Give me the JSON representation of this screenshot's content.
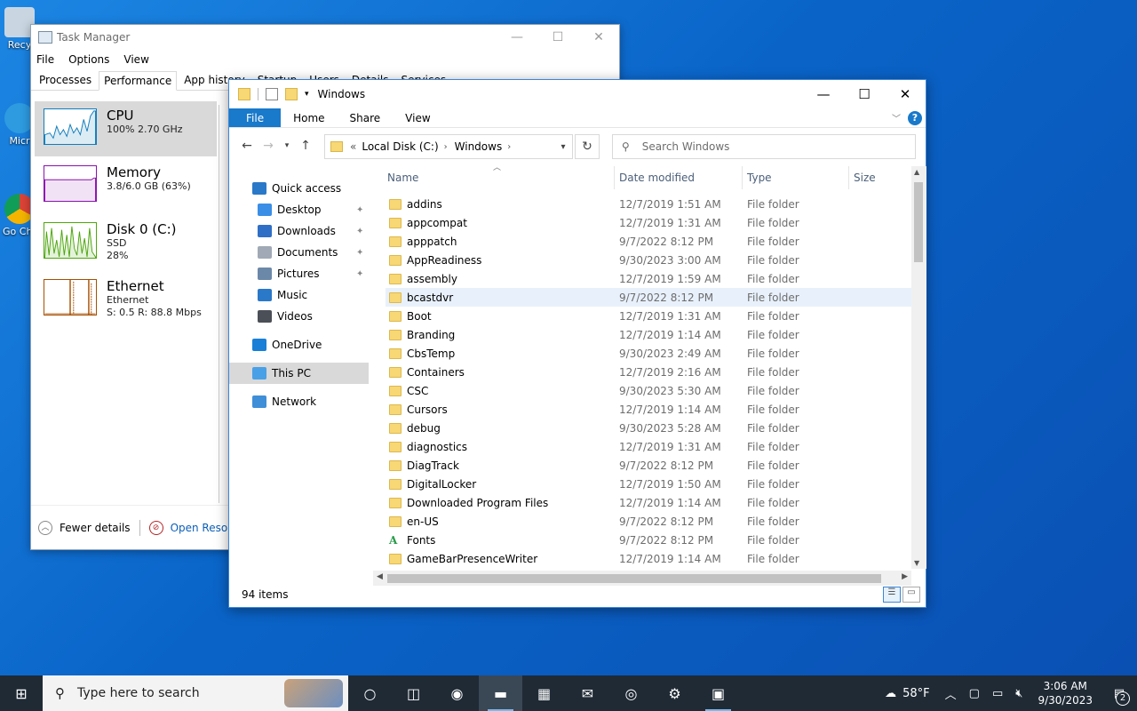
{
  "desktop": {
    "icons": [
      {
        "label": "Recy"
      },
      {
        "label": "Micr"
      },
      {
        "label": "Go Chr"
      }
    ]
  },
  "taskmgr": {
    "title": "Task Manager",
    "menu": [
      "File",
      "Options",
      "View"
    ],
    "tabs": [
      "Processes",
      "Performance",
      "App history",
      "Startup",
      "Users",
      "Details",
      "Services"
    ],
    "active_tab": "Performance",
    "perf_items": [
      {
        "name": "CPU",
        "line1": "100%  2.70 GHz",
        "line2": "",
        "color": "#117dbb"
      },
      {
        "name": "Memory",
        "line1": "3.8/6.0 GB (63%)",
        "line2": "",
        "color": "#8b12ae"
      },
      {
        "name": "Disk 0 (C:)",
        "line1": "SSD",
        "line2": "28%",
        "color": "#4da60c"
      },
      {
        "name": "Ethernet",
        "line1": "Ethernet",
        "line2": "S: 0.5  R: 88.8 Mbps",
        "color": "#a74f01"
      }
    ],
    "footer": {
      "fewer": "Fewer details",
      "resmon": "Open Resource"
    }
  },
  "explorer": {
    "title": "Windows",
    "ribbon_tabs": [
      "File",
      "Home",
      "Share",
      "View"
    ],
    "address": {
      "prefix": "«",
      "crumbs": [
        "Local Disk (C:)",
        "Windows"
      ]
    },
    "search_placeholder": "Search Windows",
    "nav": [
      {
        "label": "Quick access",
        "icon": "star-icon",
        "color": "#2a78c8",
        "level": 0,
        "pinned": false
      },
      {
        "label": "Desktop",
        "icon": "desktop-icon",
        "color": "#3a8ee6",
        "level": 1,
        "pinned": true
      },
      {
        "label": "Downloads",
        "icon": "download-icon",
        "color": "#2f6fc6",
        "level": 1,
        "pinned": true
      },
      {
        "label": "Documents",
        "icon": "document-icon",
        "color": "#a0a9b5",
        "level": 1,
        "pinned": true
      },
      {
        "label": "Pictures",
        "icon": "pictures-icon",
        "color": "#6b88a8",
        "level": 1,
        "pinned": true
      },
      {
        "label": "Music",
        "icon": "music-icon",
        "color": "#2a78c8",
        "level": 1,
        "pinned": false
      },
      {
        "label": "Videos",
        "icon": "video-icon",
        "color": "#4b4f57",
        "level": 1,
        "pinned": false
      },
      {
        "label": "OneDrive",
        "icon": "cloud-icon",
        "color": "#1a7fd6",
        "level": 0,
        "pinned": false
      },
      {
        "label": "This PC",
        "icon": "computer-icon",
        "color": "#4aa0e6",
        "level": 0,
        "pinned": false,
        "selected": true
      },
      {
        "label": "Network",
        "icon": "network-icon",
        "color": "#3f8fd8",
        "level": 0,
        "pinned": false
      }
    ],
    "columns": [
      "Name",
      "Date modified",
      "Type",
      "Size"
    ],
    "files": [
      {
        "name": "addins",
        "date": "12/7/2019 1:51 AM",
        "type": "File folder"
      },
      {
        "name": "appcompat",
        "date": "12/7/2019 1:31 AM",
        "type": "File folder"
      },
      {
        "name": "apppatch",
        "date": "9/7/2022 8:12 PM",
        "type": "File folder"
      },
      {
        "name": "AppReadiness",
        "date": "9/30/2023 3:00 AM",
        "type": "File folder"
      },
      {
        "name": "assembly",
        "date": "12/7/2019 1:59 AM",
        "type": "File folder"
      },
      {
        "name": "bcastdvr",
        "date": "9/7/2022 8:12 PM",
        "type": "File folder",
        "hover": true
      },
      {
        "name": "Boot",
        "date": "12/7/2019 1:31 AM",
        "type": "File folder"
      },
      {
        "name": "Branding",
        "date": "12/7/2019 1:14 AM",
        "type": "File folder"
      },
      {
        "name": "CbsTemp",
        "date": "9/30/2023 2:49 AM",
        "type": "File folder"
      },
      {
        "name": "Containers",
        "date": "12/7/2019 2:16 AM",
        "type": "File folder"
      },
      {
        "name": "CSC",
        "date": "9/30/2023 5:30 AM",
        "type": "File folder"
      },
      {
        "name": "Cursors",
        "date": "12/7/2019 1:14 AM",
        "type": "File folder"
      },
      {
        "name": "debug",
        "date": "9/30/2023 5:28 AM",
        "type": "File folder"
      },
      {
        "name": "diagnostics",
        "date": "12/7/2019 1:31 AM",
        "type": "File folder"
      },
      {
        "name": "DiagTrack",
        "date": "9/7/2022 8:12 PM",
        "type": "File folder"
      },
      {
        "name": "DigitalLocker",
        "date": "12/7/2019 1:50 AM",
        "type": "File folder"
      },
      {
        "name": "Downloaded Program Files",
        "date": "12/7/2019 1:14 AM",
        "type": "File folder"
      },
      {
        "name": "en-US",
        "date": "9/7/2022 8:12 PM",
        "type": "File folder"
      },
      {
        "name": "Fonts",
        "date": "9/7/2022 8:12 PM",
        "type": "File folder",
        "icon": "font"
      },
      {
        "name": "GameBarPresenceWriter",
        "date": "12/7/2019 1:14 AM",
        "type": "File folder"
      }
    ],
    "status": "94 items"
  },
  "taskbar": {
    "search_placeholder": "Type here to search",
    "apps": [
      {
        "name": "task-view-icon",
        "glyph": "◫"
      },
      {
        "name": "edge-icon",
        "glyph": "◉"
      },
      {
        "name": "file-explorer-icon",
        "glyph": "▬",
        "active": true
      },
      {
        "name": "store-icon",
        "glyph": "▦"
      },
      {
        "name": "mail-icon",
        "glyph": "✉"
      },
      {
        "name": "chrome-icon",
        "glyph": "◎"
      },
      {
        "name": "settings-icon",
        "glyph": "⚙"
      },
      {
        "name": "task-manager-icon",
        "glyph": "▣",
        "open": true
      }
    ],
    "weather": "58°F",
    "time": "3:06 AM",
    "date": "9/30/2023",
    "notifications": "2"
  }
}
